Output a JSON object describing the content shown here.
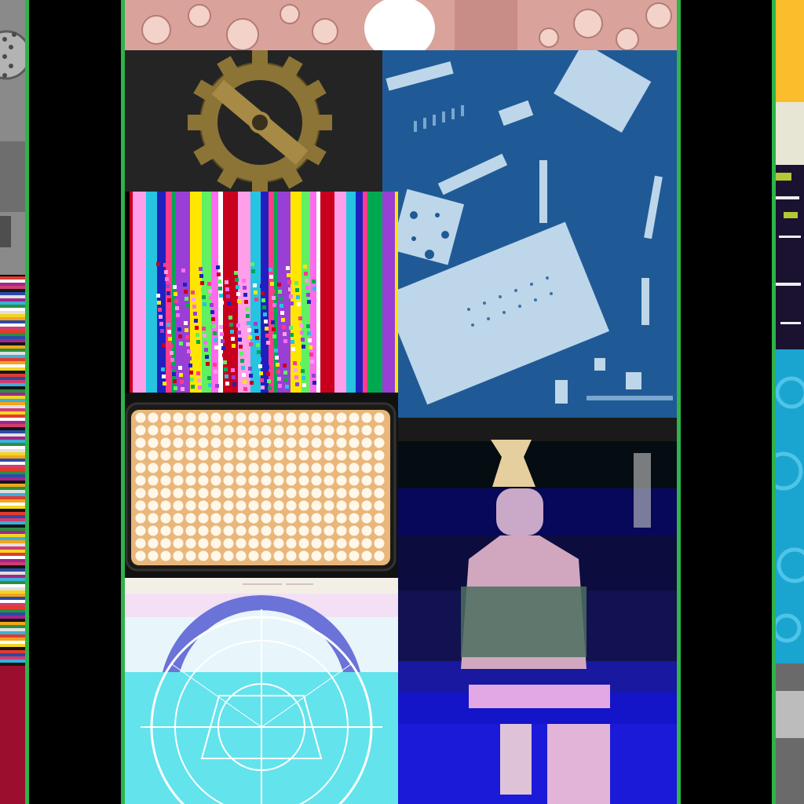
{
  "collage": {
    "tiles": [
      {
        "subject": "pink-textured-surface-with-bumps"
      },
      {
        "subject": "golden-gear-emblem-with-diagonal-bar"
      },
      {
        "subject": "cyanotype-of-perforated-metal-plates"
      },
      {
        "subject": "glitched-vertical-color-bands"
      },
      {
        "subject": "led-panel-grid-of-lights"
      },
      {
        "subject": "glitched-blue-figure-collage"
      },
      {
        "subject": "cyan-tinted-astronomical-dial-diagram"
      }
    ],
    "side_strips": [
      "left-grey-machine-and-rainbow-bands",
      "right-yellow-glitch-and-blue-gears"
    ],
    "handwriting_snippet": ""
  },
  "colors": {
    "border_green": "#2fb34a",
    "background": "#000000",
    "cyanotype_blue": "#1f5a96",
    "led_warm": "#f4c891",
    "glitch_blue": "#1414c8"
  }
}
